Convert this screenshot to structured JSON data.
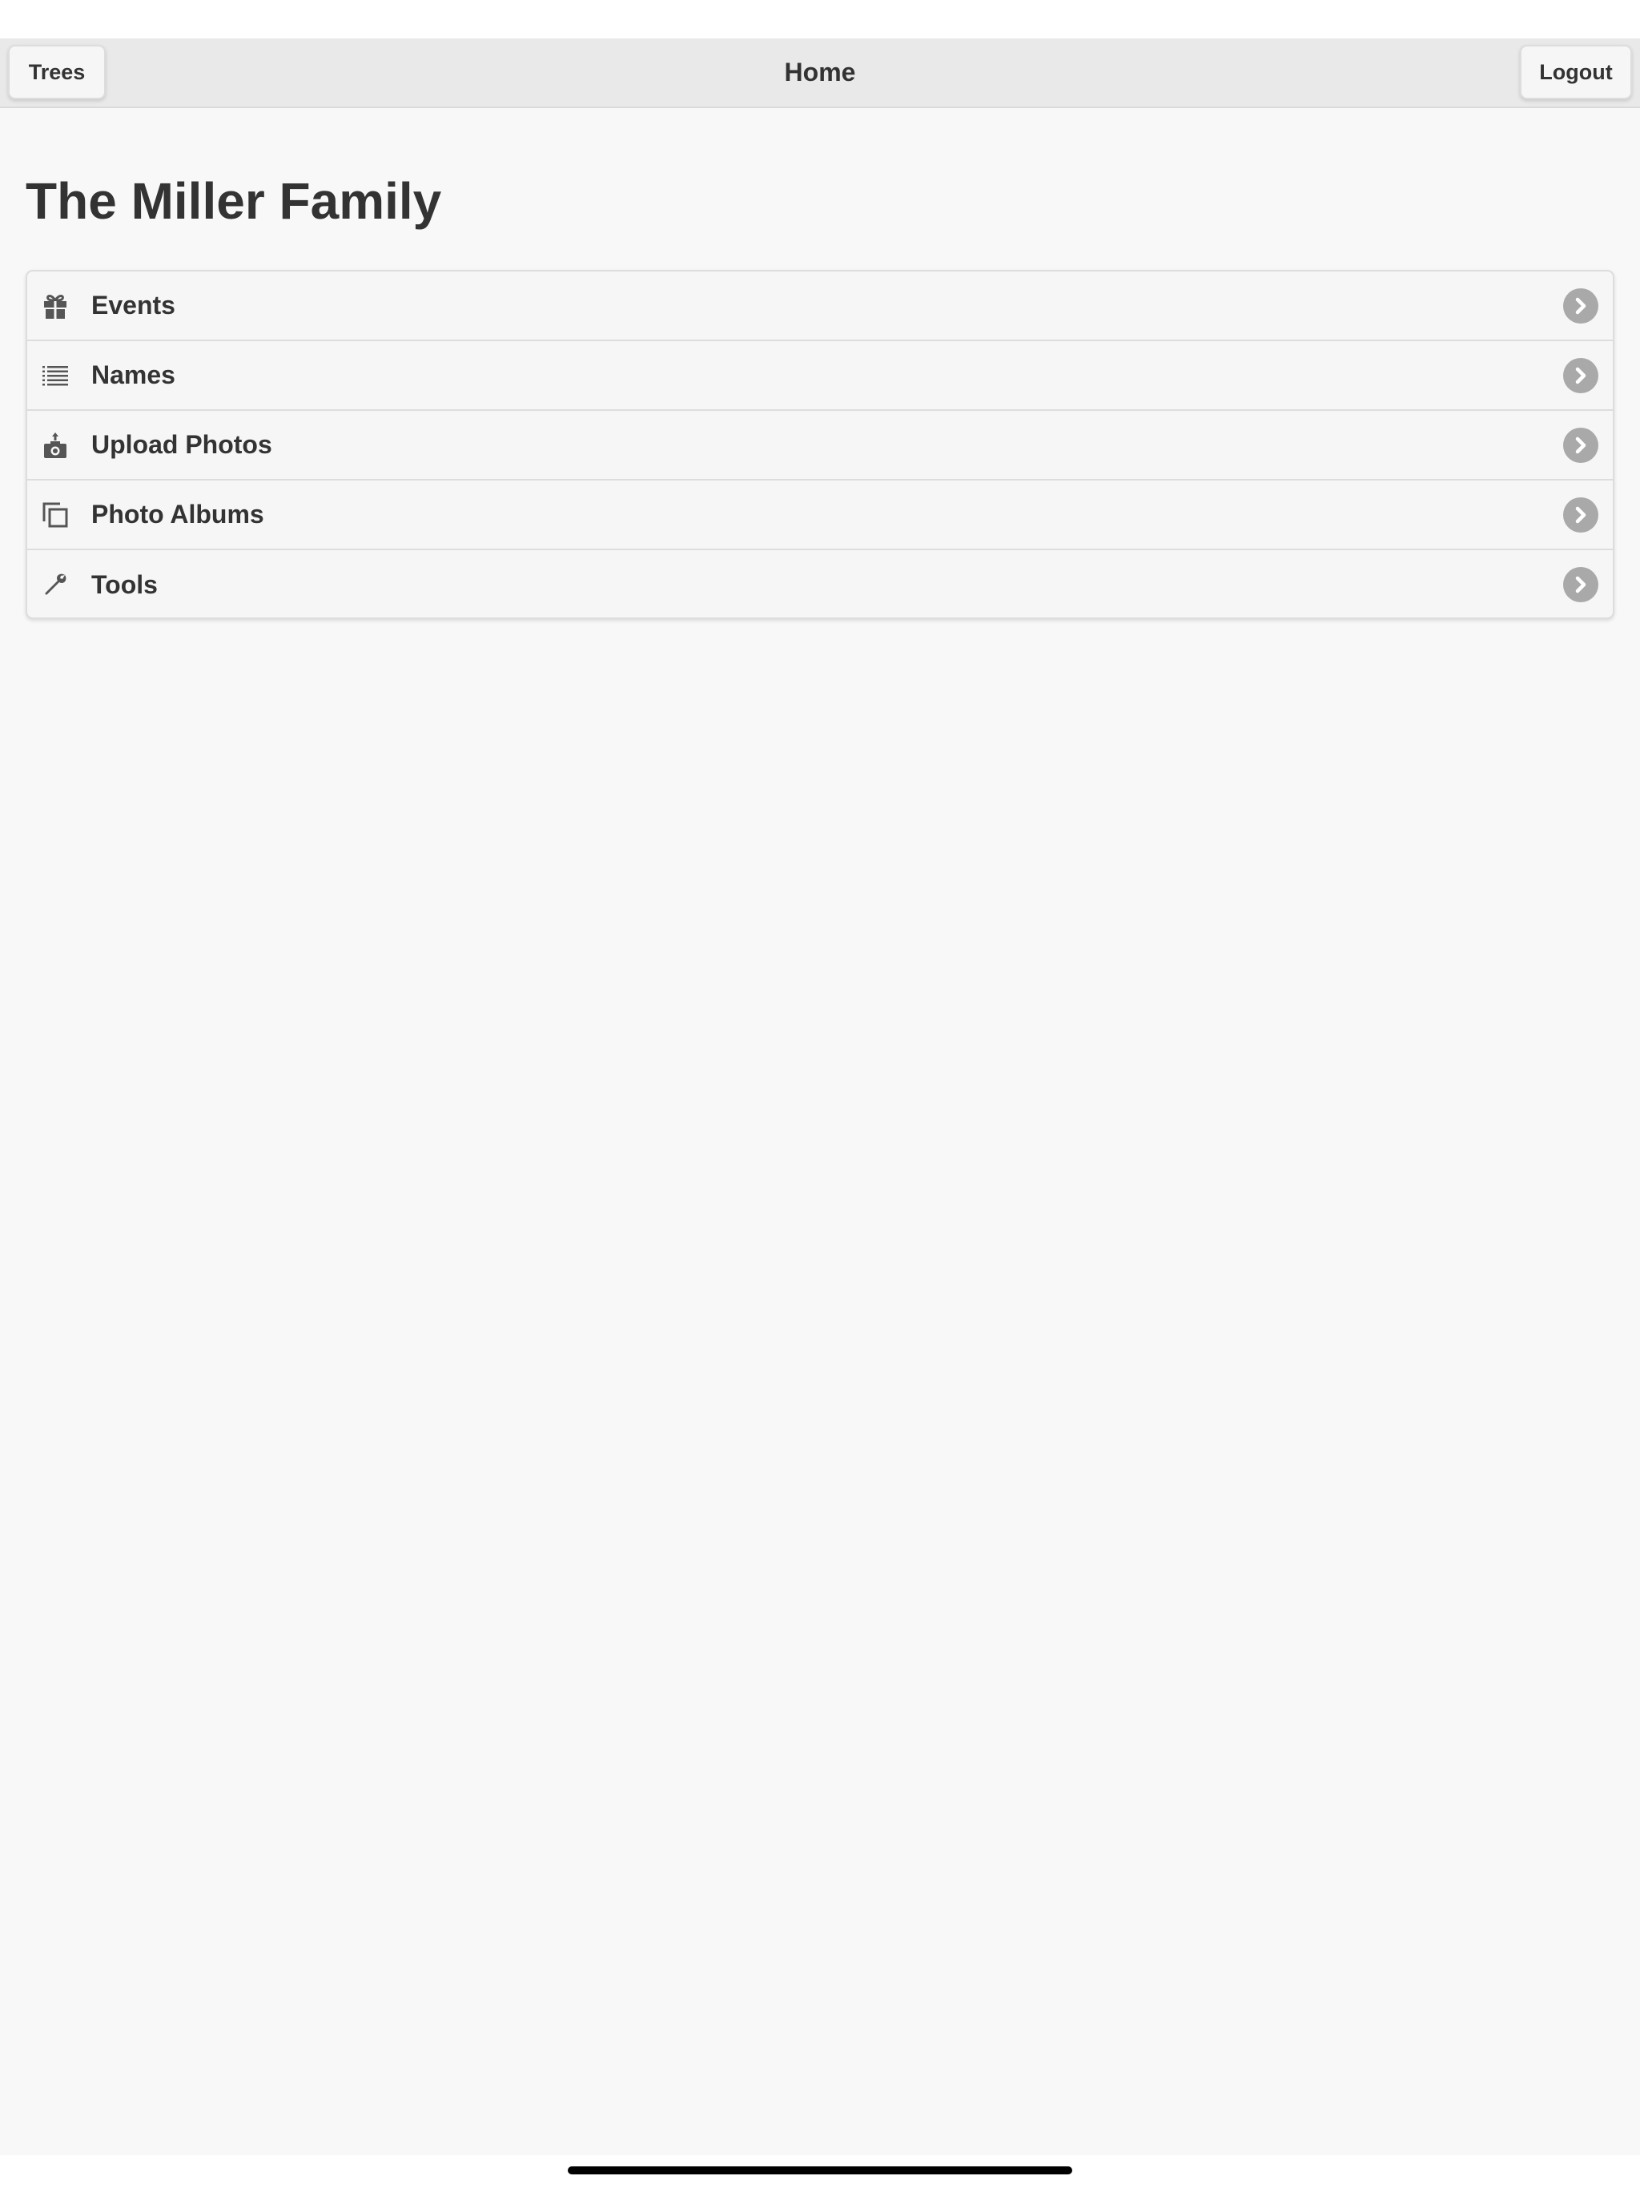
{
  "header": {
    "left_button": "Trees",
    "title": "Home",
    "right_button": "Logout"
  },
  "main": {
    "title": "The Miller Family",
    "menu": [
      {
        "label": "Events",
        "icon": "gift-icon"
      },
      {
        "label": "Names",
        "icon": "list-icon"
      },
      {
        "label": "Upload Photos",
        "icon": "camera-upload-icon"
      },
      {
        "label": "Photo Albums",
        "icon": "photo-albums-icon"
      },
      {
        "label": "Tools",
        "icon": "wrench-icon"
      }
    ]
  },
  "colors": {
    "header_bg": "#e9e9e9",
    "content_bg": "#f8f8f8",
    "text": "#333333",
    "chevron": "#a9a9a9"
  }
}
